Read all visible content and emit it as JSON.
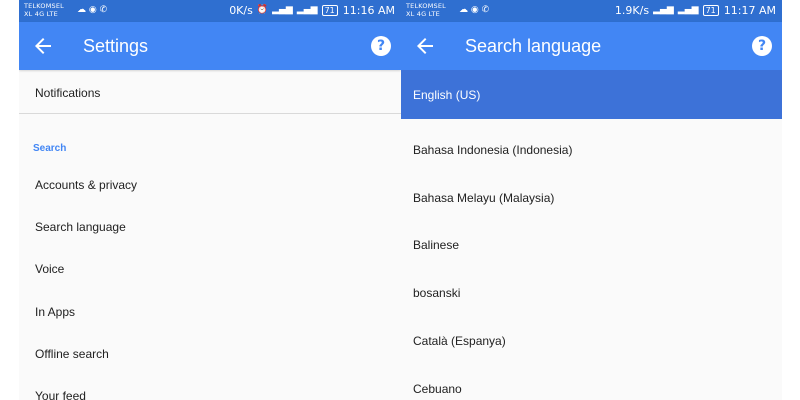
{
  "colors": {
    "statusbar": "#2f6fd0",
    "appbar": "#4286f4",
    "selected_row": "#3d72d8",
    "section_header": "#4286f4"
  },
  "left_phone": {
    "status": {
      "carrier_line1": "TELKOMSEL",
      "carrier_line2": "XL 4G LTE",
      "speed": "0K/s",
      "battery": "71",
      "time": "11:16 AM"
    },
    "appbar": {
      "back_icon": "arrow-back-icon",
      "title": "Settings",
      "help_icon": "help-icon",
      "help_glyph": "?"
    },
    "items_top": [
      "Notifications"
    ],
    "section": "Search",
    "items": [
      "Accounts & privacy",
      "Search language",
      "Voice",
      "In Apps",
      "Offline search",
      "Your feed"
    ]
  },
  "right_phone": {
    "status": {
      "carrier_line1": "TELKOMSEL",
      "carrier_line2": "XL 4G LTE",
      "speed": "1.9K/s",
      "battery": "71",
      "time": "11:17 AM"
    },
    "appbar": {
      "back_icon": "arrow-back-icon",
      "title": "Search language",
      "help_icon": "help-icon",
      "help_glyph": "?"
    },
    "selected_language": "English (US)",
    "languages": [
      "Bahasa Indonesia (Indonesia)",
      "Bahasa Melayu (Malaysia)",
      "Balinese",
      "bosanski",
      "Català (Espanya)",
      "Cebuano"
    ]
  }
}
